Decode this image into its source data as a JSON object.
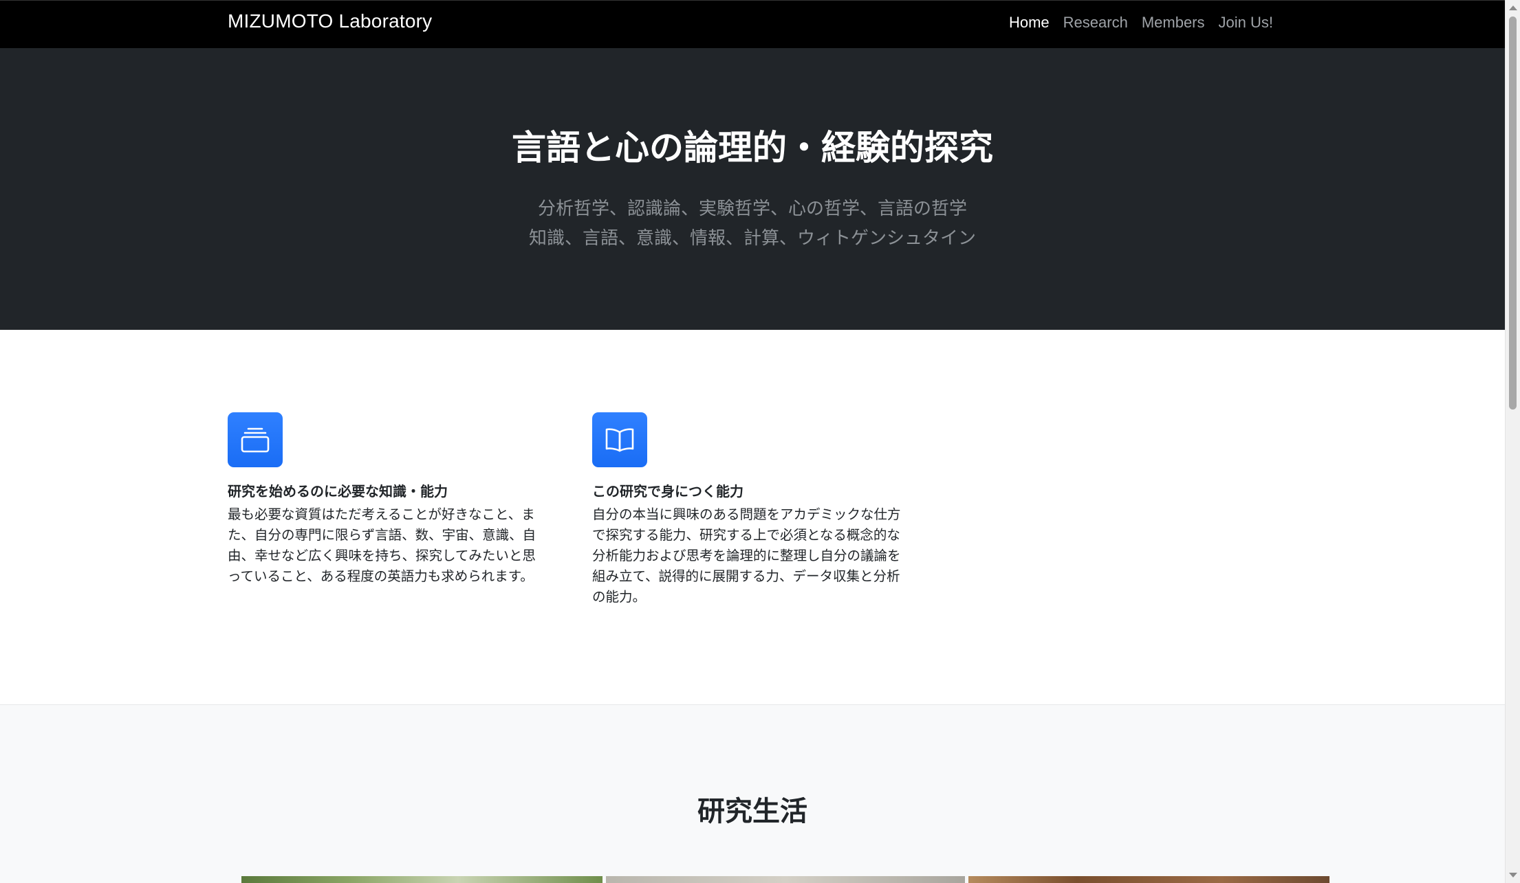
{
  "navbar": {
    "brand": "MIZUMOTO Laboratory",
    "links": [
      {
        "label": "Home",
        "active": true
      },
      {
        "label": "Research",
        "active": false
      },
      {
        "label": "Members",
        "active": false
      },
      {
        "label": "Join Us!",
        "active": false
      }
    ]
  },
  "hero": {
    "title": "言語と心の論理的・経験的探究",
    "subtitle_lines": [
      "分析哲学、認識論、実験哲学、心の哲学、言語の哲学",
      "知識、言語、意識、情報、計算、ウィトゲンシュタイン"
    ]
  },
  "features": [
    {
      "icon": "collection-icon",
      "title": "研究を始めるのに必要な知識・能力",
      "lines": [
        "最も必要な資質はただ考えることが好きなこと、ま",
        "た、自分の専門に限らず言語、数、宇宙、意識、自",
        "由、幸せなど広く興味を持ち、探究してみたいと思",
        "っていること、ある程度の英語力も求められます。"
      ]
    },
    {
      "icon": "book-icon",
      "title": "この研究で身につく能力",
      "lines": [
        "自分の本当に興味のある問題をアカデミックな仕方",
        "で探究する能力、研究する上で必須となる概念的な",
        "分析能力および思考を論理的に整理し自分の議論を",
        "組み立て、説得的に展開する力、データ収集と分析",
        "の能力。"
      ]
    }
  ],
  "life": {
    "heading": "研究生活"
  },
  "colors": {
    "navbar_bg": "#000000",
    "hero_bg": "#212529",
    "accent": "#1a6df5",
    "section_bg": "#f8f9fa"
  }
}
